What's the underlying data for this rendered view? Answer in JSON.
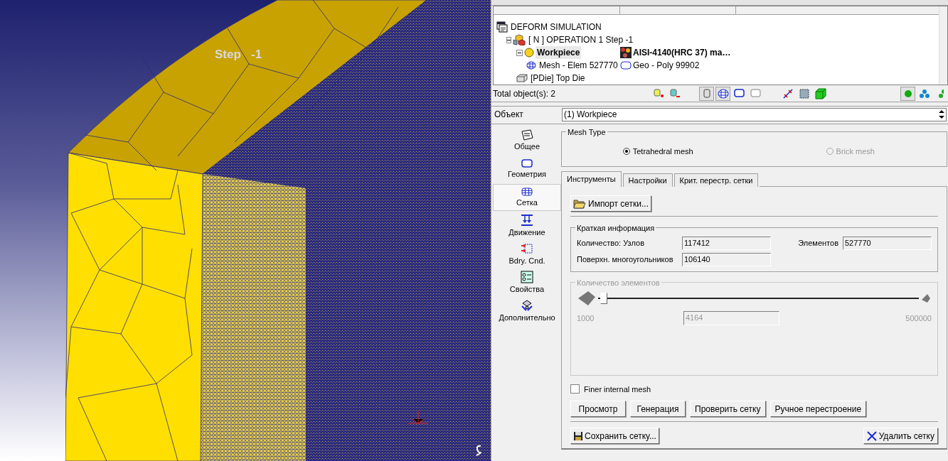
{
  "viewport": {
    "step_label": "Step   -1"
  },
  "tree": {
    "items": [
      {
        "kind": "simulation",
        "label": "DEFORM SIMULATION",
        "selected": false,
        "children": [
          {
            "kind": "operation",
            "label": "[ N ]  OPERATION 1  Step -1",
            "selected": false,
            "children": [
              {
                "kind": "workpiece",
                "label": "Workpiece",
                "detail": {
                  "kind": "material",
                  "label": "AISI-4140(HRC 37) ma…"
                },
                "selected": true,
                "children": [
                  {
                    "kind": "mesh",
                    "label": "Mesh - Elem 527770",
                    "detail": {
                      "kind": "geometry",
                      "label": "Geo - Poly 99902"
                    },
                    "selected": false
                  }
                ]
              },
              {
                "kind": "die",
                "label": "[PDie] Top Die",
                "selected": false
              }
            ]
          }
        ]
      }
    ]
  },
  "status": "Total object(s): 2",
  "toolbar": [
    {
      "kind": "add",
      "pressed": false
    },
    {
      "kind": "remove",
      "pressed": false
    },
    {
      "kind": "object",
      "pressed": true
    },
    {
      "kind": "mesh",
      "pressed": true
    },
    {
      "kind": "geometry",
      "pressed": false
    },
    {
      "kind": "geometry-off",
      "pressed": false
    },
    {
      "kind": "measure",
      "pressed": false
    },
    {
      "kind": "box",
      "pressed": false
    },
    {
      "kind": "cube",
      "pressed": false
    },
    {
      "kind": "single",
      "pressed": true
    },
    {
      "kind": "multi",
      "pressed": false
    },
    {
      "kind": "multi-green",
      "pressed": false
    }
  ],
  "object_field": {
    "label": "Объект",
    "value": "(1) Workpiece"
  },
  "nav": [
    {
      "kind": "general",
      "label": "Общее",
      "selected": false
    },
    {
      "kind": "geometry",
      "label": "Геометрия",
      "selected": false
    },
    {
      "kind": "mesh",
      "label": "Сетка",
      "selected": true
    },
    {
      "kind": "movement",
      "label": "Движение",
      "selected": false
    },
    {
      "kind": "bc",
      "label": "Bdry. Cnd.",
      "selected": false
    },
    {
      "kind": "properties",
      "label": "Свойства",
      "selected": false
    },
    {
      "kind": "advanced",
      "label": "Дополнительно",
      "selected": false
    }
  ],
  "mesh_type": {
    "title": "Mesh Type",
    "options": [
      {
        "label": "Tetrahedral mesh",
        "selected": true,
        "disabled": false
      },
      {
        "label": "Brick mesh",
        "selected": false,
        "disabled": true
      }
    ]
  },
  "tabs": [
    {
      "label": "Инструменты",
      "selected": true
    },
    {
      "label": "Настройки",
      "selected": false
    },
    {
      "label": "Крит. перестр. сетки",
      "selected": false
    }
  ],
  "import_button": "Импорт сетки...",
  "summary": {
    "title": "Краткая информация",
    "nodes_label": "Количество: Узлов",
    "nodes": "117412",
    "elements_label": "Элементов",
    "elements": "527770",
    "polygons_label": "Поверхн. многоугольников",
    "polygons": "106140"
  },
  "element_count": {
    "title": "Количество элементов",
    "disabled": true,
    "min": "1000",
    "max": "500000",
    "value": "4164",
    "level": 0.006
  },
  "finer_mesh": {
    "label": "Finer internal mesh",
    "checked": false
  },
  "actions": [
    "Просмотр",
    "Генерация",
    "Проверить сетку",
    "Ручное перестроение"
  ],
  "save_button": "Сохранить сетку...",
  "delete_button": "Удалить сетку"
}
